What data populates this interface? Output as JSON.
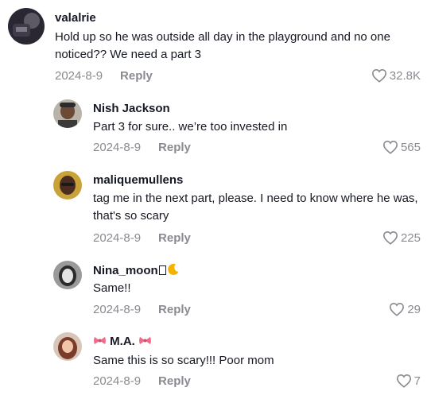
{
  "comments": [
    {
      "username": "valalrie",
      "text": "Hold up so he was outside all day in the playground and no one noticed?? We need a part 3",
      "date": "2024-8-9",
      "reply_label": "Reply",
      "likes": "32.8K"
    },
    {
      "username": "Nish Jackson",
      "text": "Part 3 for sure.. we’re too invested in",
      "date": "2024-8-9",
      "reply_label": "Reply",
      "likes": "565"
    },
    {
      "username": "maliquemullens",
      "text": "tag me in the next part, please. I need to know where he was, that's so scary",
      "date": "2024-8-9",
      "reply_label": "Reply",
      "likes": "225"
    },
    {
      "username": "Nina_moon",
      "text": "Same!!",
      "date": "2024-8-9",
      "reply_label": "Reply",
      "likes": "29"
    },
    {
      "username": "M.A.",
      "text": "Same this is so scary!!! Poor mom",
      "date": "2024-8-9",
      "reply_label": "Reply",
      "likes": "7"
    }
  ],
  "colors": {
    "text_primary": "#161823",
    "text_secondary": "#8a8b91",
    "background": "#ffffff"
  },
  "icons": [
    "heart-outline-icon",
    "bow-emoji-icon",
    "crescent-moon-emoji-icon"
  ]
}
